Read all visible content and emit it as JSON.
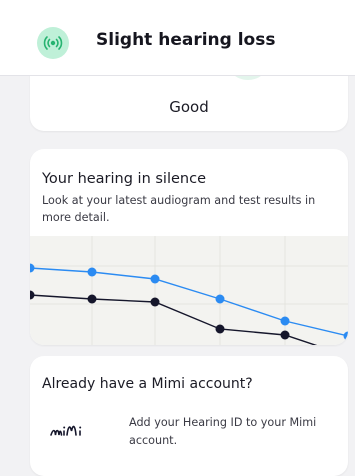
{
  "header": {
    "title": "Slight hearing loss",
    "icon": "sound-waves-icon",
    "icon_bg": "#bff0d8",
    "icon_color": "#26b370"
  },
  "status_card": {
    "value": "Good"
  },
  "silence_card": {
    "title": "Your hearing in silence",
    "description": "Look at your latest audiogram and test results in more detail."
  },
  "mimi_card": {
    "title": "Already have a Mimi account?",
    "description": "Add your Hearing ID to your Mimi account.",
    "logo": "mimi-logo"
  },
  "colors": {
    "series_left": "#2b8bf2",
    "series_right": "#15162b",
    "chart_bg": "#f3f3f0"
  }
}
